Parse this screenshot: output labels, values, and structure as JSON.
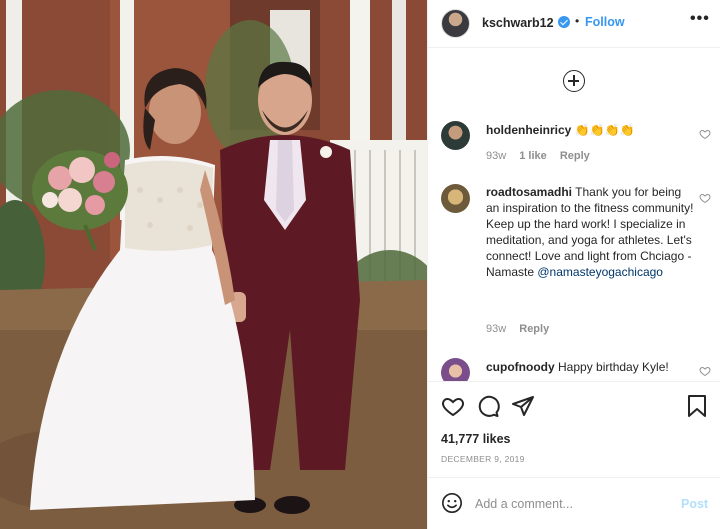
{
  "post": {
    "username": "kschwarb12",
    "follow_label": "Follow",
    "separator": "•",
    "more_label": "•••"
  },
  "comments": [
    {
      "username": "holdenheinricy",
      "text": "👏👏👏👏",
      "time": "93w",
      "likes": "1 like",
      "reply_label": "Reply"
    },
    {
      "username": "roadtosamadhi",
      "text": "Thank you for being an inspiration to the fitness community! Keep up the hard work! I specialize in meditation, and yoga for athletes. Let's connect! Love and light from Chciago - Namaste",
      "mention": "@namasteyogachicago",
      "time": "93w",
      "reply_label": "Reply"
    },
    {
      "username": "cupofnoody",
      "text": "Happy birthday Kyle!"
    }
  ],
  "stats": {
    "likes": "41,777 likes",
    "date": "DECEMBER 9, 2019"
  },
  "add_comment": {
    "placeholder": "Add a comment...",
    "post_label": "Post"
  },
  "icons": [
    "plus-circle-icon",
    "heart-icon",
    "comment-icon",
    "share-icon",
    "bookmark-icon",
    "emoji-icon",
    "verified-icon"
  ],
  "colors": {
    "accent": "#3897f0",
    "post_disabled": "#b2dffc",
    "muted": "#8e8e8e",
    "mention": "#00376b"
  }
}
